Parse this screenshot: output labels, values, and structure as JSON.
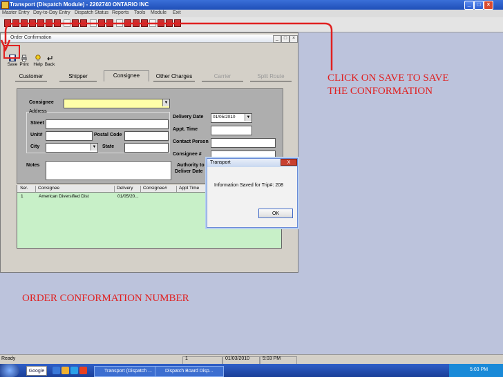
{
  "app": {
    "title": "Transport (Dispatch Module) - 2202740 ONTARIO INC"
  },
  "menu": [
    "Master Entry",
    "Day-to-Day Entry",
    "Dispatch Status",
    "Reports",
    "Tools",
    "Module",
    "Exit"
  ],
  "window": {
    "title": "Order Confirmation"
  },
  "buttons": {
    "save": "Save",
    "print": "Print",
    "help": "Help",
    "back": "Back"
  },
  "tabs": [
    "Customer",
    "Shipper",
    "Consignee",
    "Other Charges",
    "Carrier",
    "Split Route"
  ],
  "active_tab": "Consignee",
  "form": {
    "consignee_label": "Consignee",
    "address_label": "Address",
    "street_label": "Street",
    "unit_label": "Unit#",
    "postal_label": "Postal Code",
    "city_label": "City",
    "state_label": "State",
    "notes_label": "Notes",
    "delivery_date_label": "Delivery Date",
    "delivery_date_value": "01/05/2010",
    "appt_time_label": "Appt. Time",
    "contact_label": "Contact Person",
    "consignee_num_label": "Consignee #",
    "authority_label_1": "Authority to",
    "authority_label_2": "Deliver Date"
  },
  "grid": {
    "headers": [
      "Ser.",
      "Consignee",
      "Delivery",
      "Consignee#",
      "Appt Time"
    ],
    "rows": [
      {
        "ser": "1",
        "consignee": "American Diversified Dist",
        "delivery": "01/05/20..."
      }
    ]
  },
  "dialog": {
    "title": "Transport",
    "close": "X",
    "message": "Information Saved for Trip#: 208",
    "ok": "OK"
  },
  "annotations": {
    "hint_line1": "CLICK ON SAVE TO SAVE",
    "hint_line2": "THE CONFORMATION",
    "order_number": "ORDER CONFORMATION NUMBER"
  },
  "statusbar": {
    "left": "Ready",
    "page": "1",
    "date": "01/03/2010",
    "time": "5:03 PM"
  },
  "taskbar": {
    "search": "Google",
    "tasks": [
      "Transport (Dispatch ...",
      "Dispatch Board Disp..."
    ],
    "clock": "5:03 PM"
  },
  "colors": {
    "annotation": "#e02020",
    "grid_bg": "#c8f0c8",
    "consignee_field": "#ffffa8"
  }
}
